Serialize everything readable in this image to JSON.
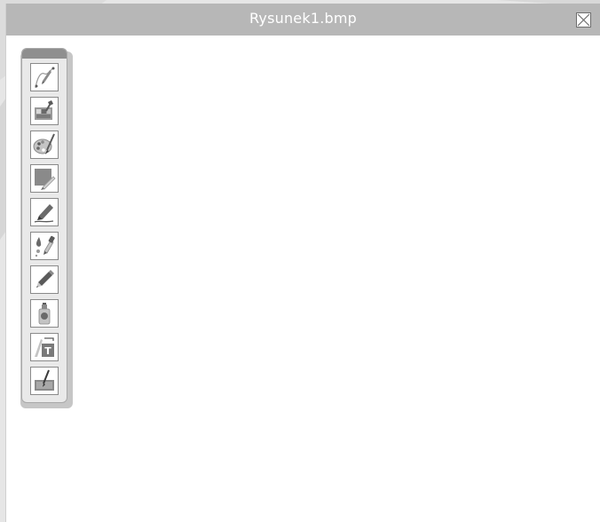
{
  "window": {
    "title": "Rysunek1.bmp"
  },
  "toolbox": {
    "tools": [
      {
        "icon": "pen-curve-icon"
      },
      {
        "icon": "paint-tools-icon"
      },
      {
        "icon": "palette-brush-icon"
      },
      {
        "icon": "fill-shape-icon"
      },
      {
        "icon": "marker-icon"
      },
      {
        "icon": "dropper-icon"
      },
      {
        "icon": "pencil-icon"
      },
      {
        "icon": "spray-can-icon"
      },
      {
        "icon": "text-tool-icon"
      },
      {
        "icon": "canvas-brush-icon"
      }
    ]
  },
  "colors": {
    "titlebar": "#b7b7b7",
    "toolbox": "#e9e9e9",
    "toolbox_header": "#8f8f8f",
    "icon_dark": "#5a5a5a",
    "icon_mid": "#9a9a9a"
  }
}
